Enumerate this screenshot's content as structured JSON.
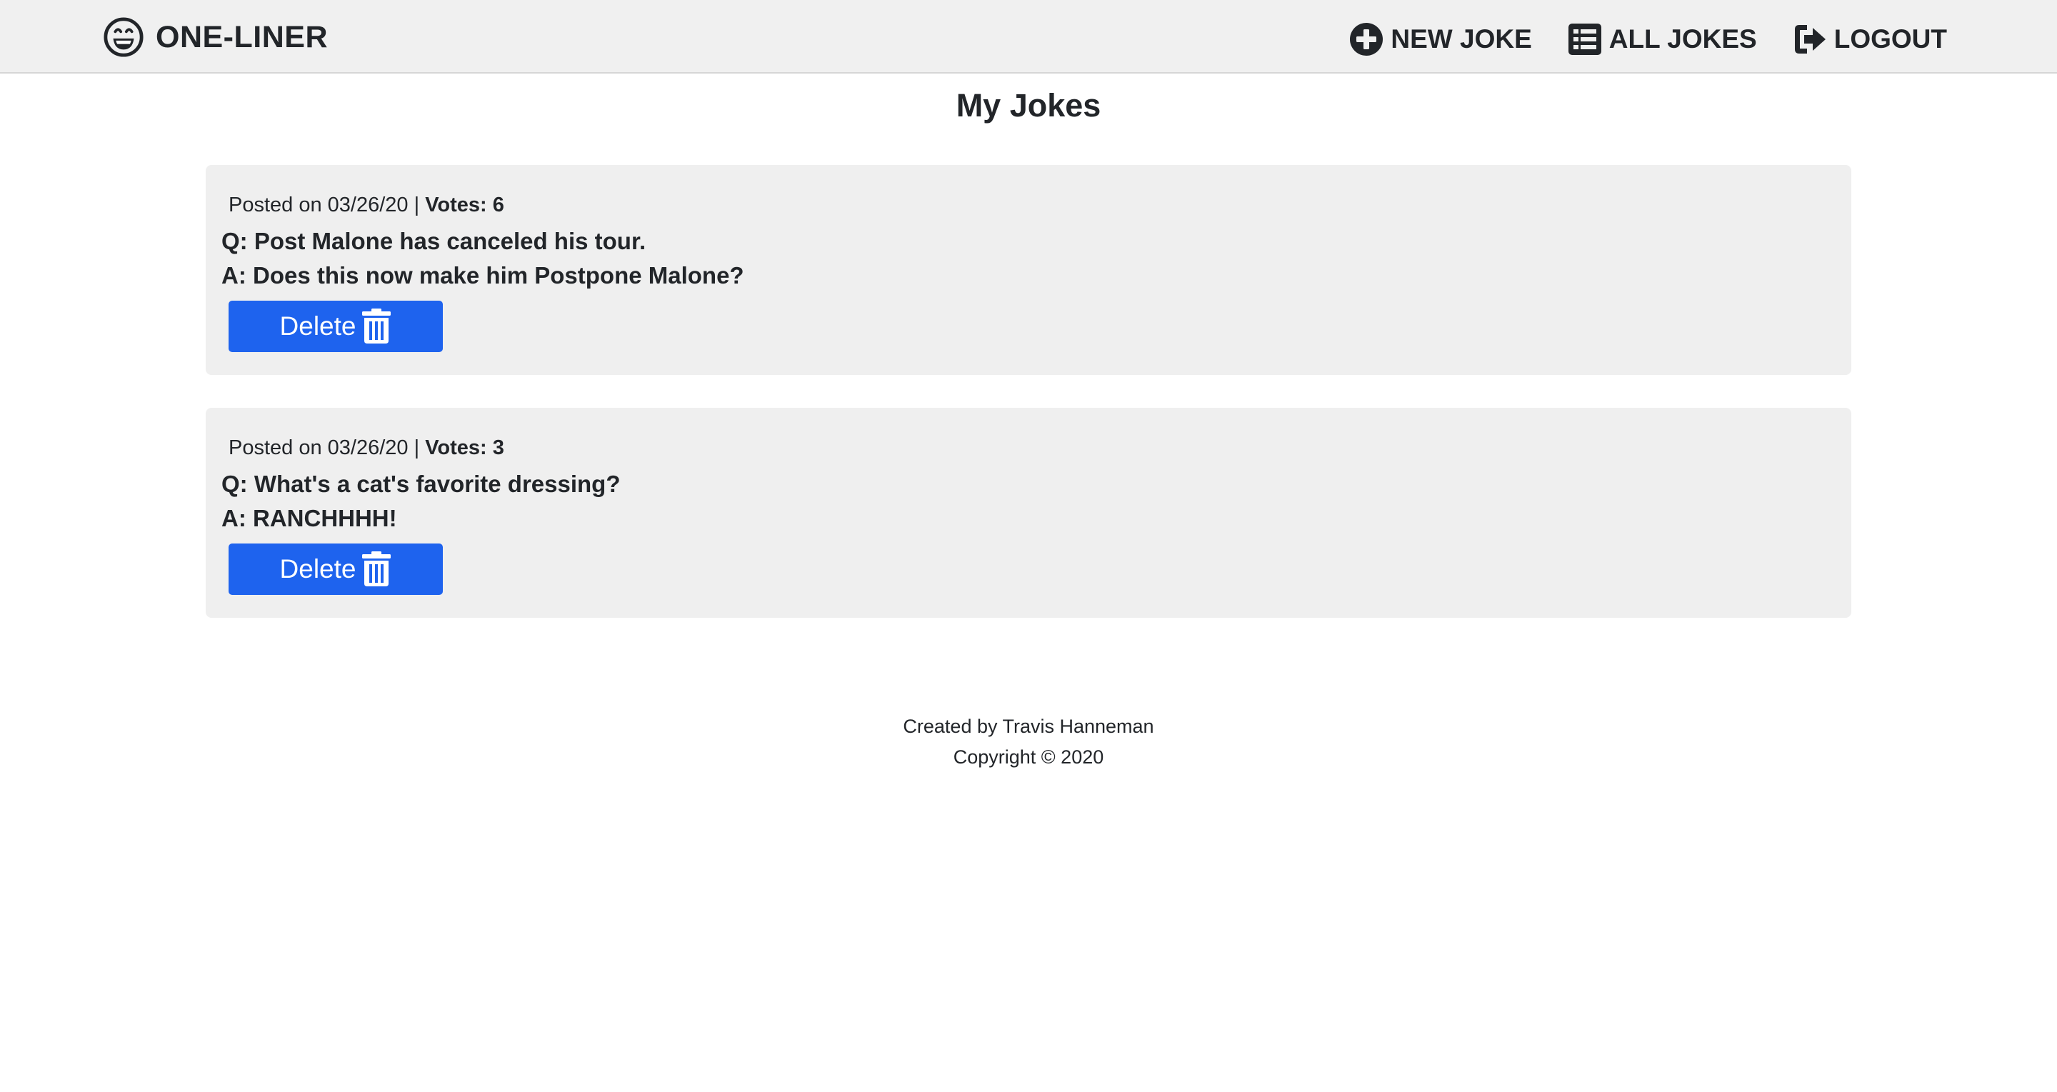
{
  "navbar": {
    "brand": {
      "name": "ONE-LINER",
      "icon": "grin-icon"
    },
    "links": [
      {
        "label": "NEW JOKE",
        "icon": "plus-circle-icon"
      },
      {
        "label": "ALL JOKES",
        "icon": "list-icon"
      },
      {
        "label": "LOGOUT",
        "icon": "sign-out-icon"
      }
    ]
  },
  "page": {
    "title": "My Jokes"
  },
  "jokes": [
    {
      "posted": "Posted on 03/26/20 | ",
      "votes": "Votes: 6",
      "question": "Q: Post Malone has canceled his tour.",
      "answer": "A: Does this now make him Postpone Malone?",
      "delete_label": "Delete"
    },
    {
      "posted": "Posted on 03/26/20 | ",
      "votes": "Votes: 3",
      "question": "Q: What's a cat's favorite dressing?",
      "answer": "A: RANCHHHH!",
      "delete_label": "Delete"
    }
  ],
  "footer": {
    "credit": "Created by Travis Hanneman",
    "copyright": "Copyright © 2020"
  },
  "colors": {
    "navbar_bg": "#f0f0f0",
    "card_bg": "#efefef",
    "button_bg": "#1e63ee",
    "text": "#222529"
  },
  "icons": {
    "delete": "trash-icon"
  }
}
